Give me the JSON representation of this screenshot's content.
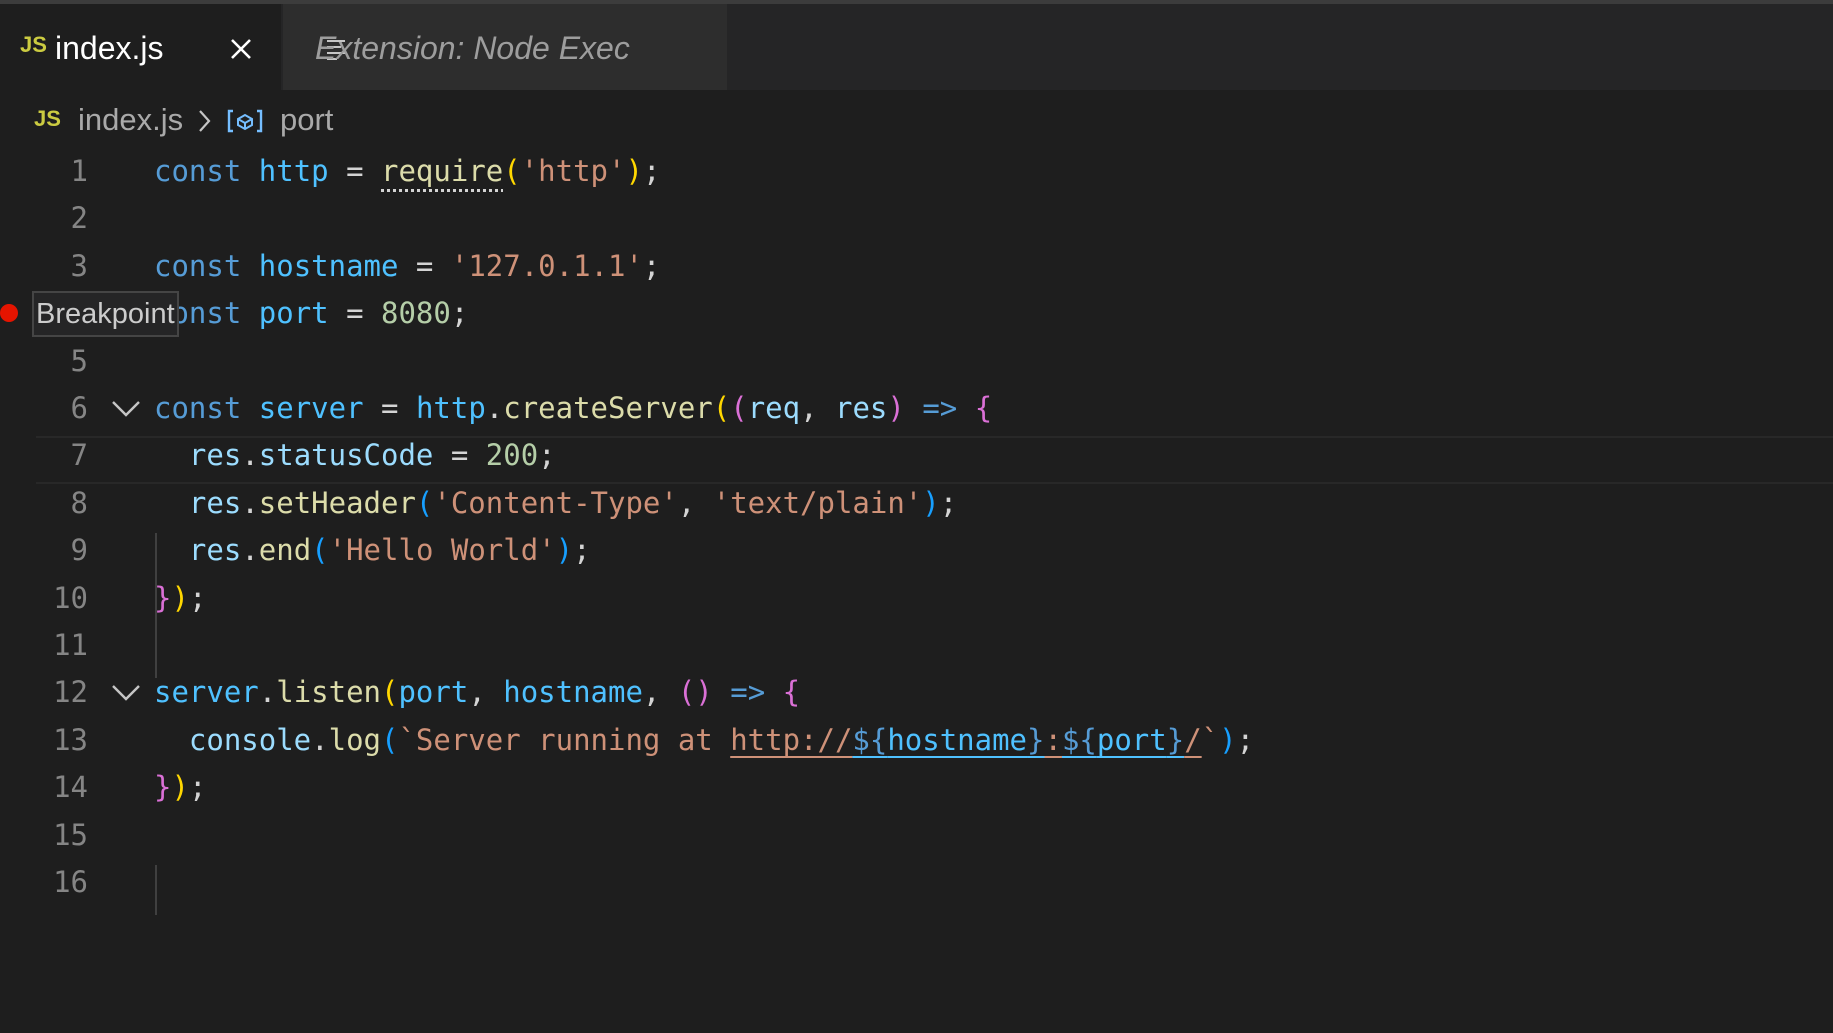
{
  "tabs": [
    {
      "icon": "js-file-icon",
      "badge": "JS",
      "label": "index.js",
      "active": true
    },
    {
      "icon": "preview-icon",
      "label": "Extension: Node Exec",
      "active": false
    }
  ],
  "breadcrumb": {
    "file_badge": "JS",
    "file": "index.js",
    "symbol_icon": "variable-symbol-icon",
    "symbol": "port"
  },
  "gutter": {
    "line_numbers": [
      "1",
      "2",
      "3",
      "4",
      "5",
      "6",
      "7",
      "8",
      "9",
      "10",
      "11",
      "12",
      "13",
      "14",
      "15",
      "16"
    ],
    "breakpoint_line": "4",
    "tooltip": "Breakpoint"
  },
  "code": {
    "l1": {
      "kw": "const",
      "name": "http",
      "op": " = ",
      "fn": "require",
      "str": "'http'",
      "end": ";"
    },
    "l3": {
      "kw": "const",
      "name": "hostname",
      "op": " = ",
      "str": "'127.0.1.1'",
      "end": ";"
    },
    "l4": {
      "kw": "const",
      "name": "port",
      "op": " = ",
      "num": "8080",
      "end": ";"
    },
    "l6": {
      "kw": "const",
      "name": "server",
      "op": " = ",
      "obj": "http",
      "dot": ".",
      "fn": "createServer",
      "p1": "req",
      "comma": ", ",
      "p2": "res",
      "arrow": "=>",
      "brace": "{"
    },
    "l7": {
      "obj": "res",
      "dot": ".",
      "prop": "statusCode",
      "op": " = ",
      "num": "200",
      "end": ";"
    },
    "l8": {
      "obj": "res",
      "dot": ".",
      "fn": "setHeader",
      "s1": "'Content-Type'",
      "comma": ", ",
      "s2": "'text/plain'",
      "end": ";"
    },
    "l9": {
      "obj": "res",
      "dot": ".",
      "fn": "end",
      "s1": "'Hello World'",
      "end": ";"
    },
    "l10": {
      "brace": "}",
      "end": ";"
    },
    "l12": {
      "obj": "server",
      "dot": ".",
      "fn": "listen",
      "a1": "port",
      "a2": "hostname",
      "comma": ", ",
      "arrow": "=>",
      "brace": "{"
    },
    "l13": {
      "obj": "console",
      "dot": ".",
      "fn": "log",
      "tpl_start": "`Server running at ",
      "url": "http://",
      "i1_open": "${",
      "i1": "hostname",
      "i1_close": "}",
      "colon": ":",
      "i2_open": "${",
      "i2": "port",
      "i2_close": "}",
      "slash": "/",
      "tpl_end": "`",
      "end": ";"
    },
    "l14": {
      "brace": "}",
      "end": ";"
    }
  },
  "colors": {
    "editor_bg": "#1e1e1e",
    "tabbar_bg": "#252526",
    "breakpoint": "#e51400",
    "js_badge": "#cbcb41"
  }
}
